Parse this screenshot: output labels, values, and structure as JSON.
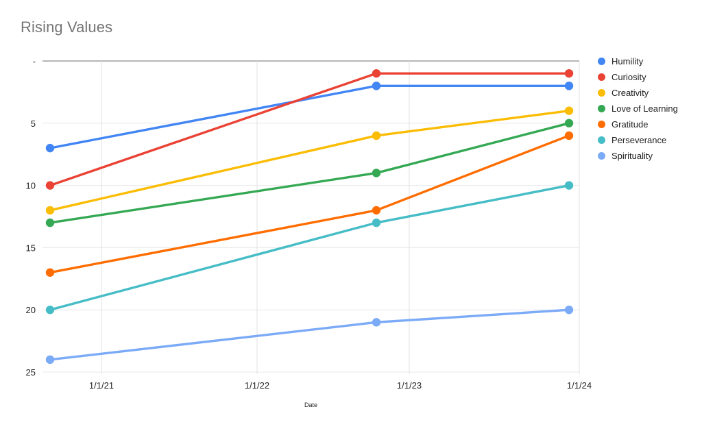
{
  "chart_data": {
    "type": "line",
    "title": "Rising Values",
    "xlabel": "Date",
    "ylabel": "",
    "x": [
      "1/1/21",
      "1/1/22",
      "1/1/23",
      "1/1/24"
    ],
    "x_tick_labels": [
      "1/1/21",
      "1/1/22",
      "1/1/23",
      "1/1/24"
    ],
    "y_tick_labels": [
      "-",
      "5",
      "10",
      "15",
      "20",
      "25"
    ],
    "y_tick_values": [
      0,
      5,
      10,
      15,
      20,
      25
    ],
    "ylim": [
      0,
      25
    ],
    "y_axis_inverted": true,
    "grid": true,
    "legend_position": "right",
    "point_x_labels": [
      "2020-11-01",
      "2022-10-15",
      "2023-11-15"
    ],
    "series": [
      {
        "name": "Humility",
        "color": "#4285f4",
        "values": [
          7,
          2,
          2
        ]
      },
      {
        "name": "Curiosity",
        "color": "#ea4335",
        "values": [
          10,
          1,
          1
        ]
      },
      {
        "name": "Creativity",
        "color": "#fbbc04",
        "values": [
          12,
          6,
          4
        ]
      },
      {
        "name": "Love of Learning",
        "color": "#34a853",
        "values": [
          13,
          9,
          5
        ]
      },
      {
        "name": "Gratitude",
        "color": "#ff6d01",
        "values": [
          17,
          12,
          6
        ]
      },
      {
        "name": "Perseverance",
        "color": "#46bdc6",
        "values": [
          20,
          13,
          10
        ]
      },
      {
        "name": "Spirituality",
        "color": "#7baaf7",
        "values": [
          24,
          21,
          20
        ]
      }
    ]
  },
  "legend": {
    "items": [
      {
        "label": "Humility"
      },
      {
        "label": "Curiosity"
      },
      {
        "label": "Creativity"
      },
      {
        "label": "Love of Learning"
      },
      {
        "label": "Gratitude"
      },
      {
        "label": "Perseverance"
      },
      {
        "label": "Spirituality"
      }
    ]
  },
  "axes": {
    "x_title": "Date",
    "x_ticks": [
      "1/1/21",
      "1/1/22",
      "1/1/23",
      "1/1/24"
    ],
    "y_ticks": [
      "-",
      "5",
      "10",
      "15",
      "20",
      "25"
    ]
  },
  "title": "Rising Values"
}
